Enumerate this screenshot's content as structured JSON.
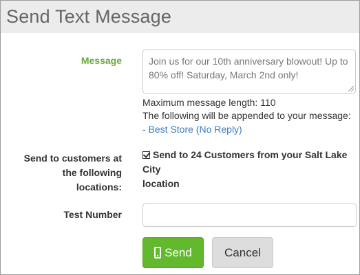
{
  "page": {
    "title": "Send Text Message"
  },
  "message": {
    "label": "Message",
    "value": "Join us for our 10th anniversary blowout! Up to 80% off! Saturday, March 2nd only!",
    "max_length_text": "Maximum message length: 110",
    "append_notice": "The following will be appended to your message:",
    "appended_text": "- Best Store (No Reply)"
  },
  "locations": {
    "label_line1": "Send to customers at",
    "label_line2": "the following",
    "label_line3": "locations:",
    "option_line1": "Send to 24 Customers from your Salt Lake City",
    "option_line2": "location",
    "checked": true
  },
  "test_number": {
    "label": "Test Number",
    "value": ""
  },
  "buttons": {
    "send": "Send",
    "cancel": "Cancel"
  },
  "colors": {
    "accent_green": "#62b92d",
    "label_green": "#6aa93b",
    "link_blue": "#3a7cc2"
  }
}
